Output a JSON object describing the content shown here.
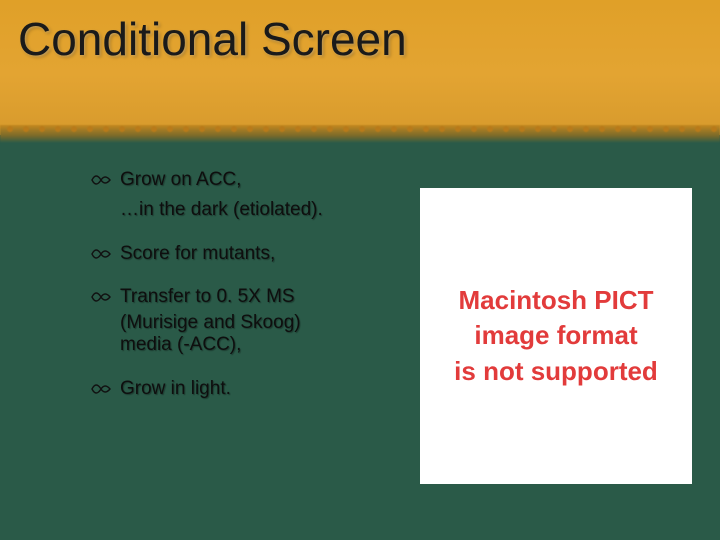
{
  "title": "Conditional Screen",
  "bullets": [
    {
      "text": "Grow on ACC,"
    },
    {
      "text": "…in the dark (etiolated).",
      "noGlyph": true
    },
    {
      "text": "Score for mutants,"
    },
    {
      "text": "Transfer to 0. 5X MS",
      "sub": [
        "(Murisige and Skoog)",
        "media (-ACC),"
      ]
    },
    {
      "text": "Grow in light."
    }
  ],
  "imagePlaceholder": {
    "line1": "Macintosh PICT",
    "line2": "image format",
    "line3": "is not supported"
  },
  "colors": {
    "headerTop": "#e0a028",
    "bodyBg": "#2a5a48",
    "placeholderText": "#e23b3b"
  }
}
